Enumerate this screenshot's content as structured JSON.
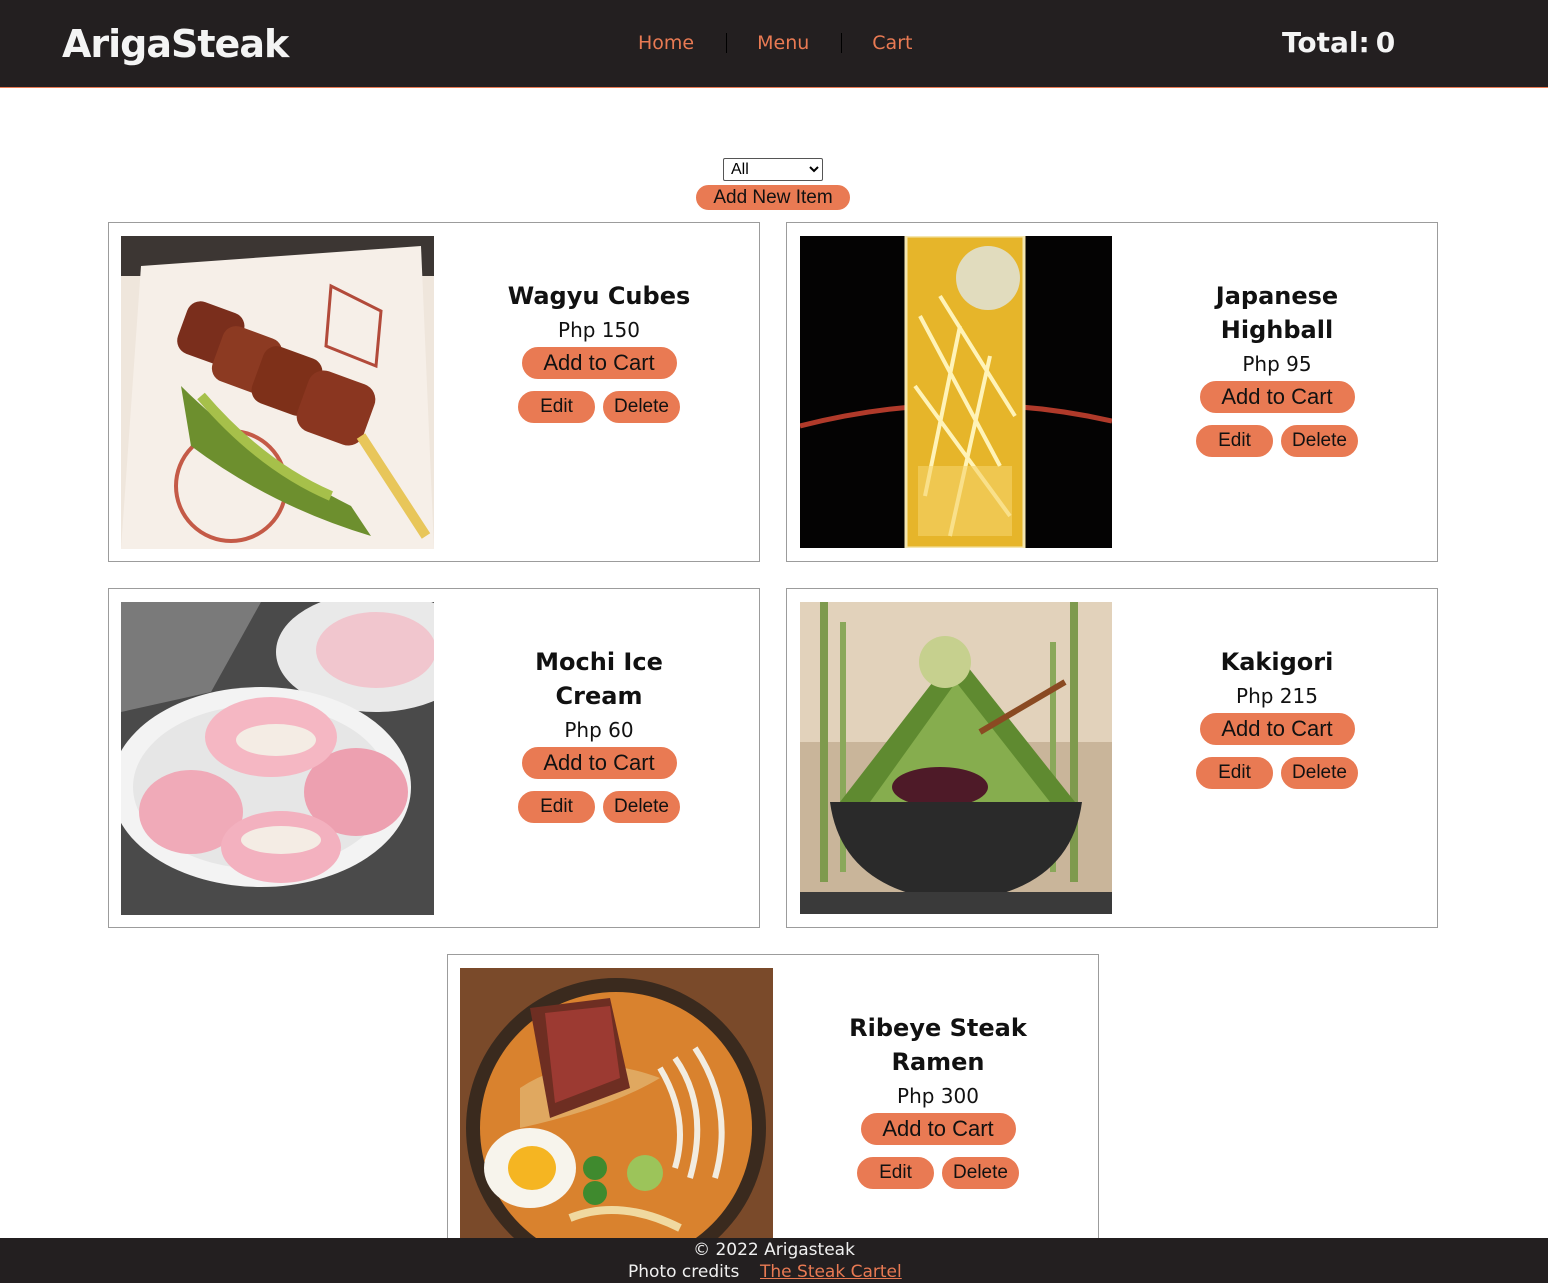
{
  "header": {
    "brand": "ArigaSteak",
    "nav": {
      "home": "Home",
      "menu": "Menu",
      "cart": "Cart"
    },
    "total_label": "Total:",
    "total_value": "0"
  },
  "controls": {
    "filter_selected": "All",
    "add_new_label": "Add New Item"
  },
  "items": [
    {
      "name": "Wagyu Cubes",
      "price": "Php 150",
      "cart_label": "Add to Cart",
      "edit_label": "Edit",
      "delete_label": "Delete"
    },
    {
      "name": "Japanese Highball",
      "price": "Php 95",
      "cart_label": "Add to Cart",
      "edit_label": "Edit",
      "delete_label": "Delete"
    },
    {
      "name": "Mochi Ice Cream",
      "price": "Php 60",
      "cart_label": "Add to Cart",
      "edit_label": "Edit",
      "delete_label": "Delete"
    },
    {
      "name": "Kakigori",
      "price": "Php 215",
      "cart_label": "Add to Cart",
      "edit_label": "Edit",
      "delete_label": "Delete"
    },
    {
      "name": "Ribeye Steak Ramen",
      "price": "Php 300",
      "cart_label": "Add to Cart",
      "edit_label": "Edit",
      "delete_label": "Delete"
    }
  ],
  "footer": {
    "copyright": "© 2022 Arigasteak",
    "credits_label": "Photo credits",
    "credits_link": "The Steak Cartel"
  },
  "colors": {
    "header_bg": "#231f20",
    "accent": "#e97a53",
    "border": "#9c9c9c"
  }
}
